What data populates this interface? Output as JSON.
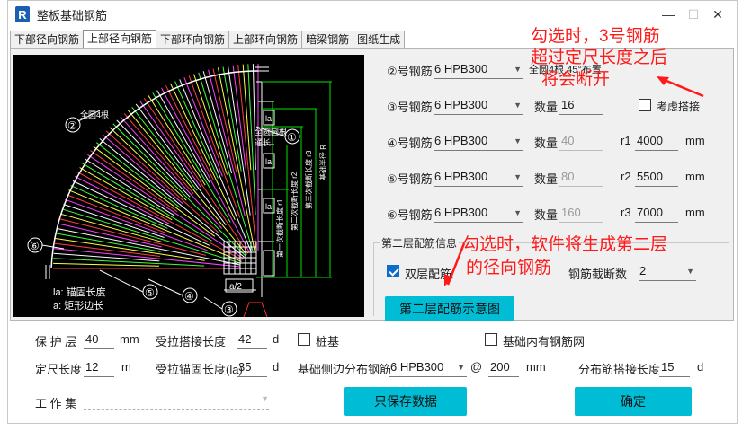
{
  "window": {
    "title": "整板基础钢筋",
    "icon_letter": "R",
    "min_glyph": "—",
    "max_glyph": "☐",
    "close_glyph": "✕"
  },
  "tabs": [
    {
      "label": "下部径向钢筋"
    },
    {
      "label": "上部径向钢筋"
    },
    {
      "label": "下部环向钢筋"
    },
    {
      "label": "上部环向钢筋"
    },
    {
      "label": "暗梁钢筋"
    },
    {
      "label": "图纸生成"
    }
  ],
  "diagram": {
    "labels": {
      "all_4": "全圆4根",
      "all_circle": "全圆圆根",
      "spacing": "通长",
      "la": "la",
      "a_half": "a/2",
      "r1": "第一次截断长度 r1",
      "r2": "第二次截断长度 r2",
      "r3": "第三次截断长度 r3",
      "R": "基础半径 R",
      "legend_la": "la: 锚固长度",
      "legend_a": "a: 矩形边长"
    },
    "circles": [
      "①",
      "②",
      "③",
      "④",
      "⑤",
      "⑥"
    ]
  },
  "right_panel": {
    "bar2": {
      "label": "②号钢筋",
      "value": "6 HPB300",
      "note": "全圆4根,45°布置"
    },
    "bar3": {
      "label": "③号钢筋",
      "value": "6 HPB300",
      "qty_label": "数量",
      "qty": "16",
      "overlap_label": "考虑搭接"
    },
    "bar4": {
      "label": "④号钢筋",
      "value": "6 HPB300",
      "qty_label": "数量",
      "qty": "40",
      "r_label": "r1",
      "r": "4000",
      "unit": "mm"
    },
    "bar5": {
      "label": "⑤号钢筋",
      "value": "6 HPB300",
      "qty_label": "数量",
      "qty": "80",
      "r_label": "r2",
      "r": "5500",
      "unit": "mm"
    },
    "bar6": {
      "label": "⑥号钢筋",
      "value": "6 HPB300",
      "qty_label": "数量",
      "qty": "160",
      "r_label": "r3",
      "r": "7000",
      "unit": "mm"
    },
    "second_layer": {
      "group_title": "第二层配筋信息",
      "double_label": "双层配筋",
      "cut_label": "钢筋截断数",
      "cut_value": "2",
      "diagram_button": "第二层配筋示意图"
    }
  },
  "annotations": {
    "note1_line1": "勾选时，3号钢筋",
    "note1_line2": "超过定尺长度之后",
    "note1_line3": "将会断开",
    "note2_line1": "勾选时，软件将生成第二层",
    "note2_line2": "的径向钢筋",
    "color": "#ff1a1a"
  },
  "bottom": {
    "cover_label": "保 护 层",
    "cover_value": "40",
    "cover_unit": "mm",
    "lap_label": "受拉搭接长度",
    "lap_value": "42",
    "lap_unit": "d",
    "pile_label": "桩基",
    "inner_label": "基础内有钢筋网",
    "fixed_label": "定尺长度",
    "fixed_value": "12",
    "fixed_unit": "m",
    "anchor_label": "受拉锚固长度(la)",
    "anchor_value": "35",
    "anchor_unit": "d",
    "side_label": "基础侧边分布钢筋",
    "side_value": "6 HPB300",
    "at_sign": "@",
    "side_spacing": "200",
    "side_unit": "mm",
    "dist_lap_label": "分布筋搭接长度",
    "dist_lap_value": "15",
    "dist_lap_unit": "d",
    "workset_label": "工 作 集",
    "save_button": "只保存数据",
    "ok_button": "确定"
  },
  "colors": {
    "accent_button": "#00bcd4",
    "checkbox_on": "#0d6cc9",
    "diagram_bg": "#000000"
  }
}
